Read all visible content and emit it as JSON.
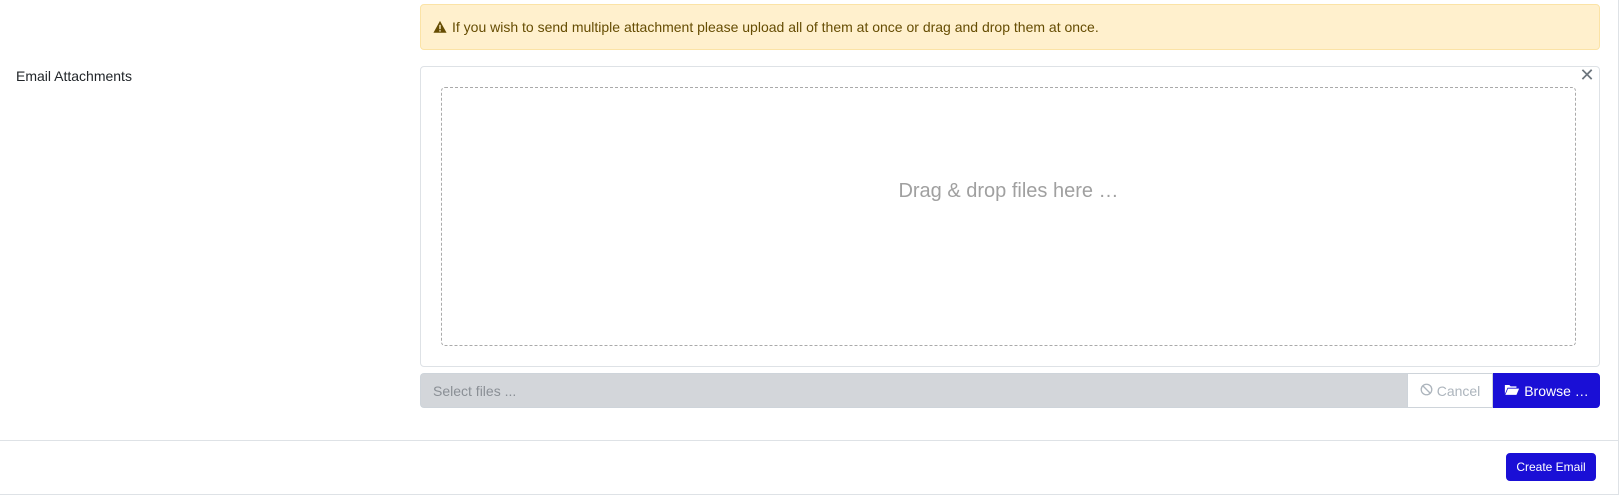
{
  "alert": {
    "icon": "warning-triangle-icon",
    "text": "If you wish to send multiple attachment please upload all of them at once or drag and drop them at once."
  },
  "attachments": {
    "label": "Email Attachments",
    "close_symbol": "✕",
    "drop_text": "Drag & drop files here …",
    "caption_placeholder": "Select files ...",
    "cancel_label": "Cancel",
    "browse_label": "Browse …"
  },
  "footer": {
    "create_label": "Create Email"
  },
  "colors": {
    "primary": "#1a0fd6",
    "alert_bg": "#fff0cd",
    "alert_text": "#664d03"
  }
}
